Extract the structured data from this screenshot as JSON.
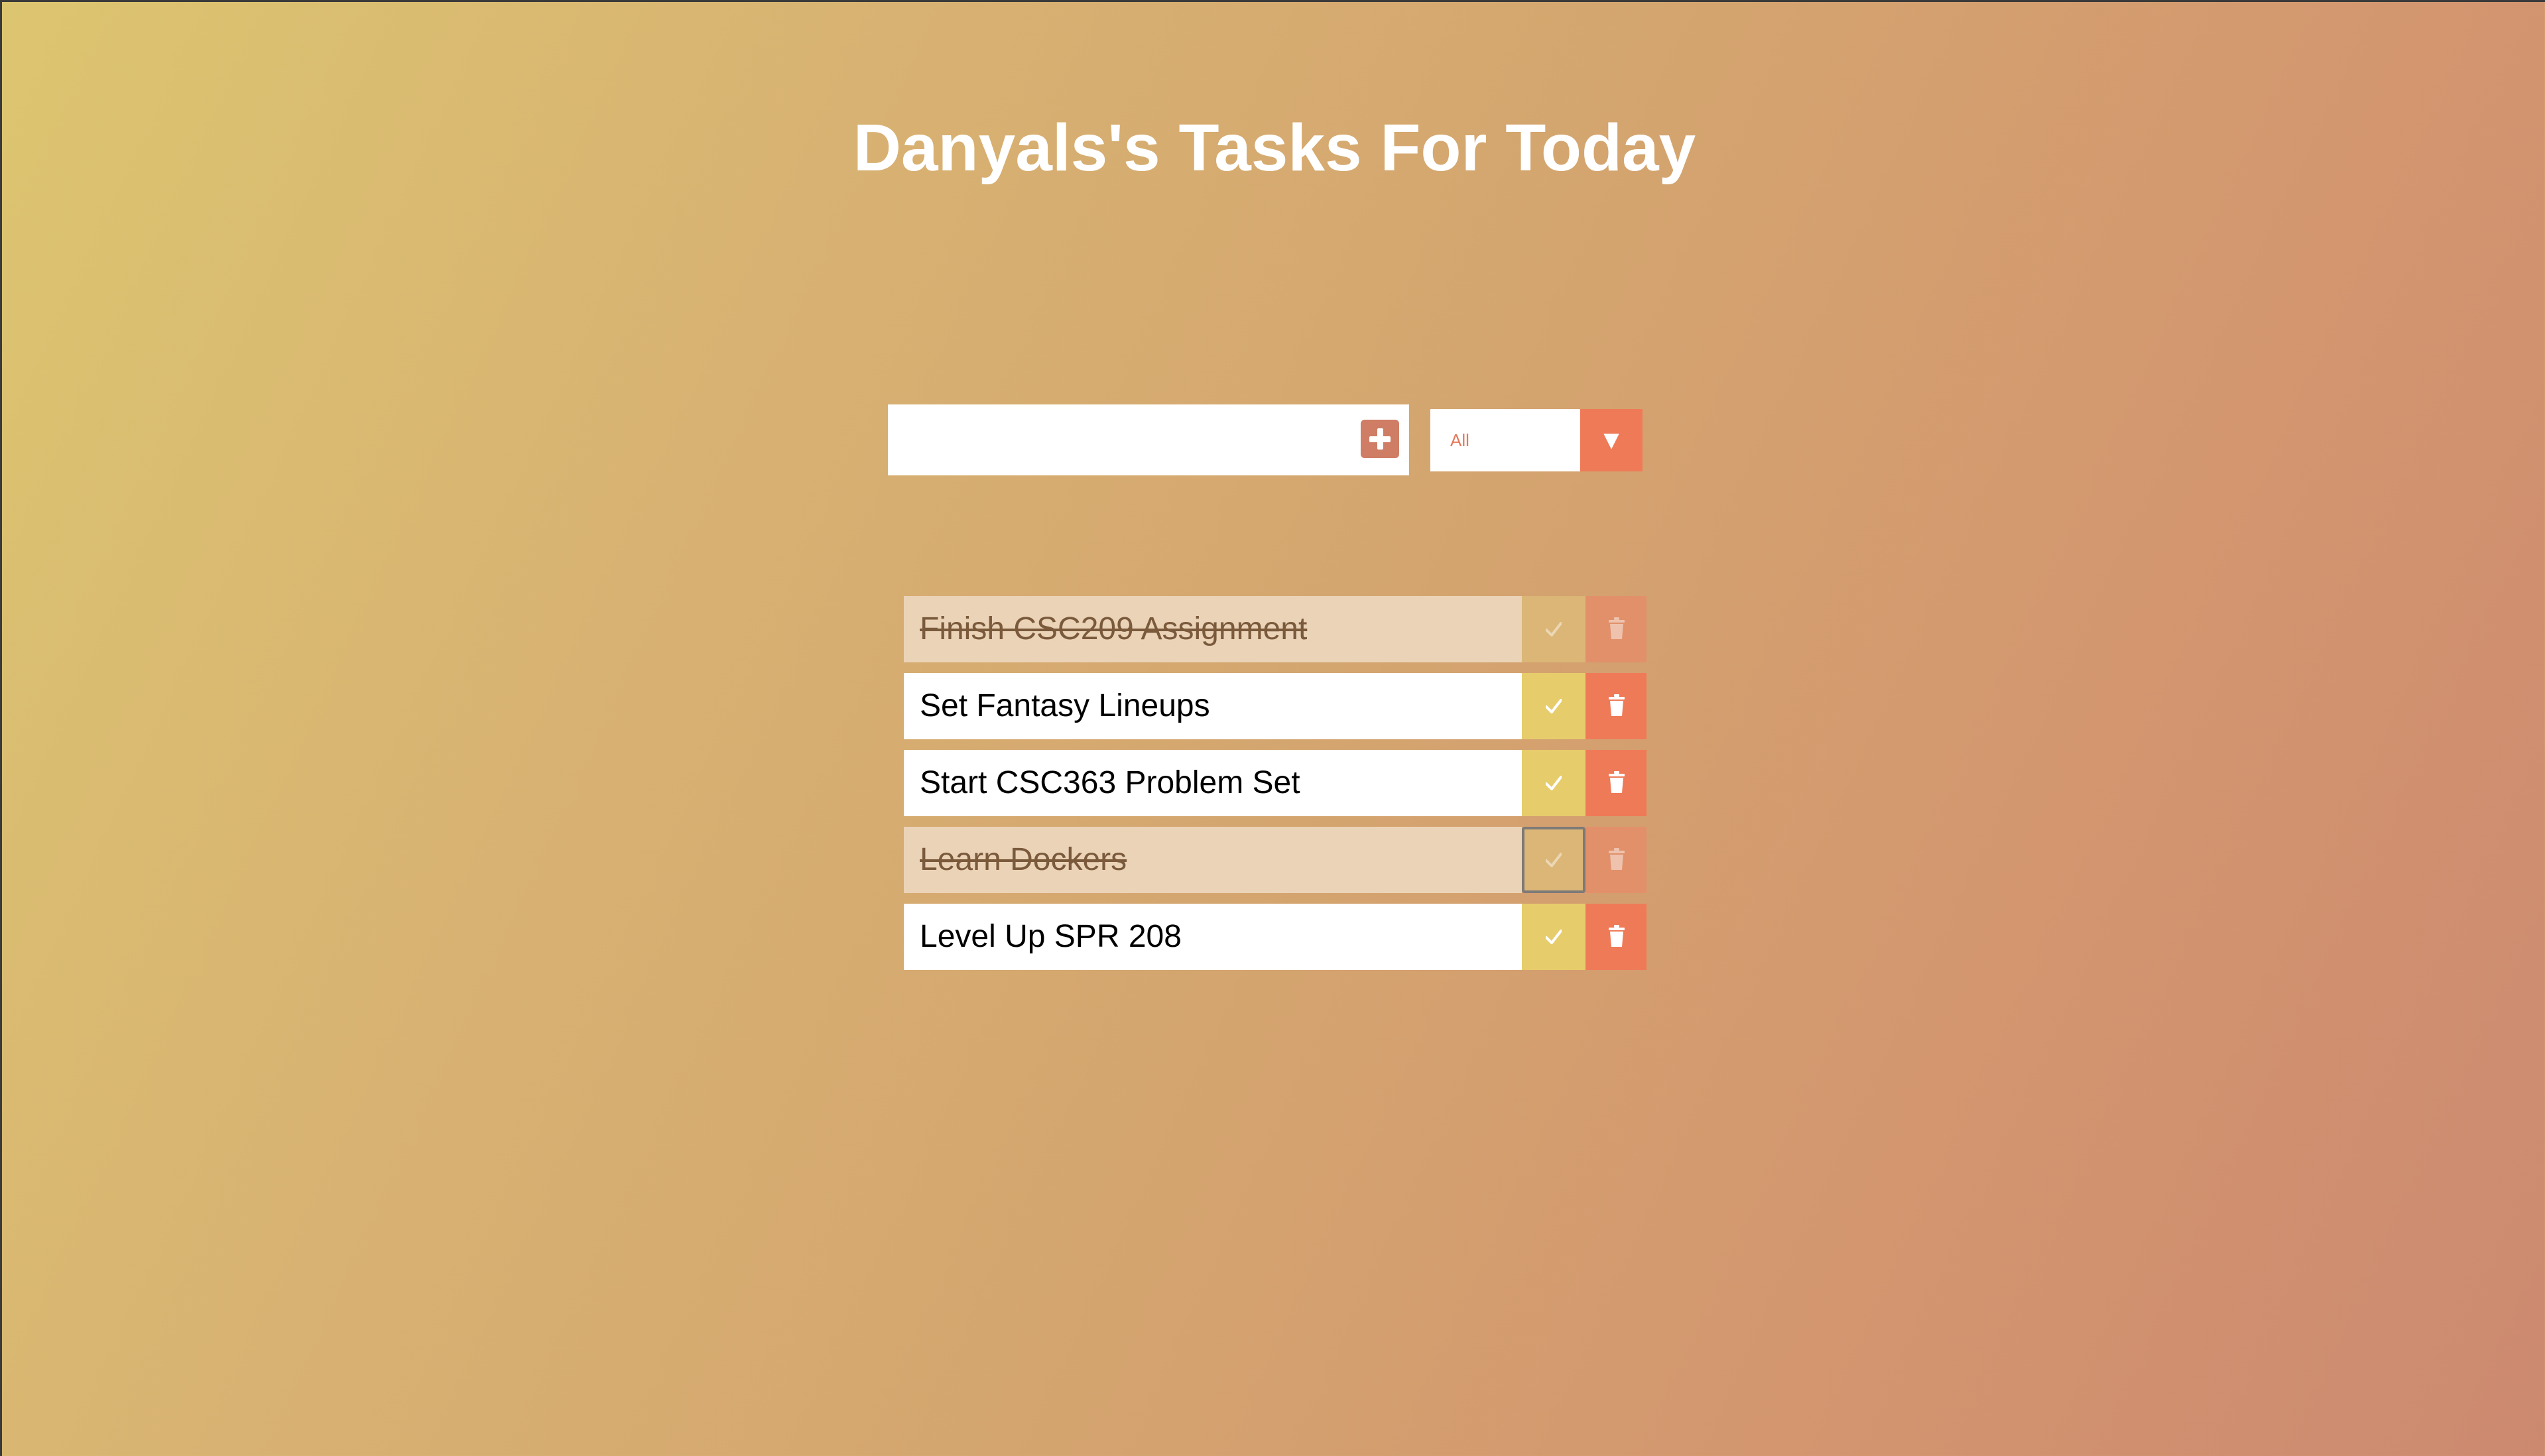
{
  "page": {
    "title": "Danyals's Tasks For Today"
  },
  "input": {
    "value": "",
    "placeholder": ""
  },
  "filter": {
    "selected": "All",
    "arrow_glyph": "▼"
  },
  "todos": [
    {
      "text": "Finish CSC209 Assignment",
      "completed": true
    },
    {
      "text": "Set Fantasy Lineups",
      "completed": false
    },
    {
      "text": "Start CSC363 Problem Set",
      "completed": false
    },
    {
      "text": "Learn Dockers",
      "completed": true
    },
    {
      "text": "Level Up SPR 208",
      "completed": false
    }
  ],
  "icons": {
    "add": "plus-square-icon",
    "complete": "check-icon",
    "delete": "trash-icon",
    "dropdown": "triangle-down-icon"
  },
  "colors": {
    "gradient_start": "#dcc570",
    "gradient_end": "#cc8970",
    "accent": "#ef7a58",
    "check_button": "#e7cc6c",
    "add_button": "#cf7d64",
    "completed_row": "#ebd3b8"
  }
}
